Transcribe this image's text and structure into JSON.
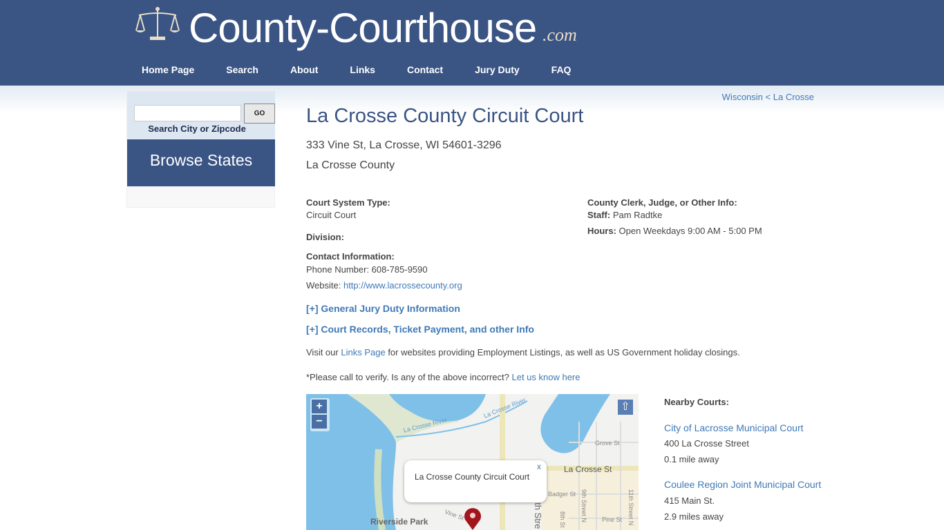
{
  "header": {
    "logo": "County-Courthouse",
    "logo_suffix": ".com",
    "nav": [
      "Home Page",
      "Search",
      "About",
      "Links",
      "Contact",
      "Jury Duty",
      "FAQ"
    ]
  },
  "sidebar": {
    "go": "GO",
    "search_label": "Search City or Zipcode",
    "search_value": "",
    "browse": "Browse States"
  },
  "breadcrumb": {
    "state": "Wisconsin",
    "sep": "<",
    "county": "La Crosse"
  },
  "court": {
    "title": "La Crosse County Circuit Court",
    "address": "333 Vine St, La Crosse, WI 54601-3296",
    "county": "La Crosse County",
    "system_label": "Court System Type:",
    "system": "Circuit Court",
    "division_label": "Division:",
    "contact_label": "Contact Information:",
    "phone": "Phone Number: 608-785-9590",
    "website_label": "Website:",
    "website": "http://www.lacrossecounty.org",
    "clerk_label": "County Clerk, Judge, or Other Info:",
    "staff_label": "Staff:",
    "staff": "Pam Radtke",
    "hours_label": "Hours:",
    "hours": "Open Weekdays 9:00 AM - 5:00 PM",
    "jury_link": "[+] General Jury Duty Information",
    "records_link": "[+] Court Records, Ticket Payment, and other Info",
    "visit_pre": "Visit our",
    "links_page": "Links Page",
    "visit_post": "for websites providing Employment Listings, as well as US Government holiday closings.",
    "verify": "*Please call to verify. Is any of the above incorrect?",
    "let_us_know": "Let us know here"
  },
  "map": {
    "zoom_in": "+",
    "zoom_out": "−",
    "reset": "⇧",
    "popup": "La Crosse County Circuit Court",
    "close": "x",
    "labels": [
      "La Crosse River",
      "La Crosse River",
      "Grove St",
      "La Crosse St",
      "Badger St",
      "9th Street N",
      "8th St",
      "11th Street N",
      "Pine St",
      "Vine St",
      "Riverside Park",
      "7th Stre"
    ]
  },
  "nearby": {
    "title": "Nearby Courts:",
    "items": [
      {
        "name": "City of Lacrosse Municipal Court",
        "address": "400 La Crosse Street",
        "distance": "0.1 mile away"
      },
      {
        "name": "Coulee Region Joint Municipal Court",
        "address": "415 Main St.",
        "distance": "2.9 miles away"
      }
    ]
  }
}
